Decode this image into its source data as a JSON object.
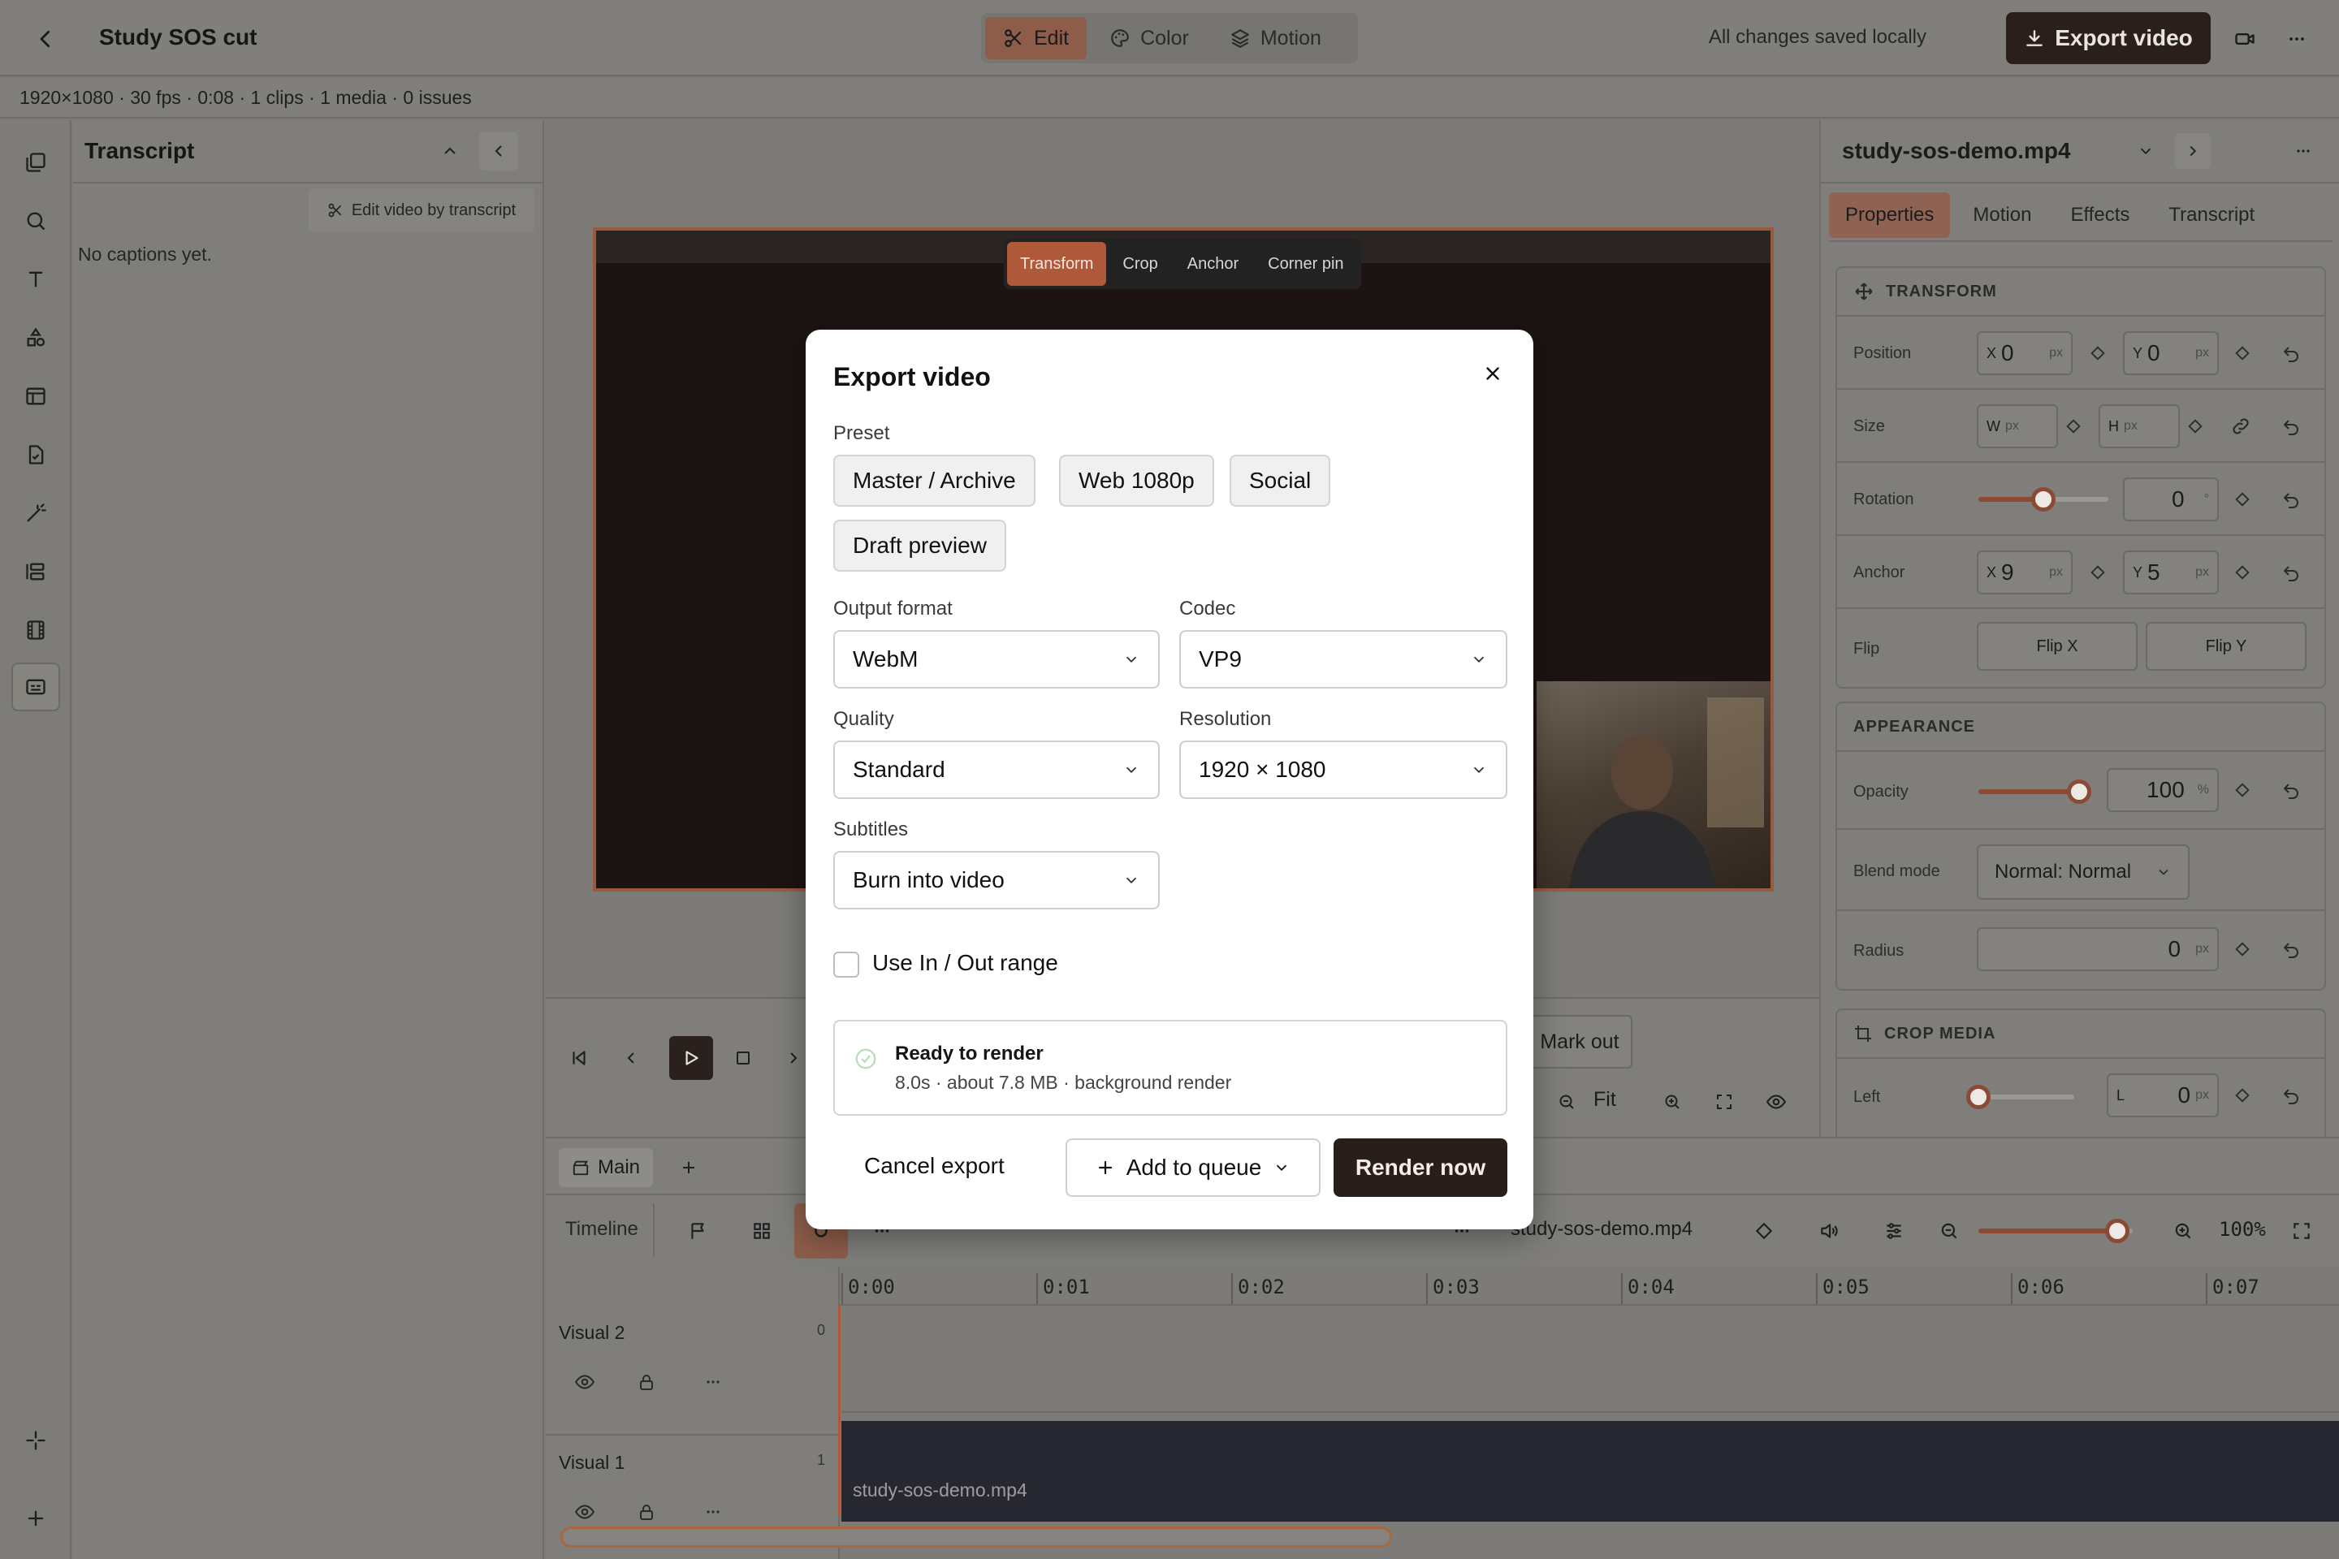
{
  "header": {
    "title": "Study SOS cut",
    "modes": [
      {
        "label": "Edit",
        "active": true
      },
      {
        "label": "Color",
        "active": false
      },
      {
        "label": "Motion",
        "active": false
      }
    ],
    "save_status": "All changes saved locally",
    "export_label": "Export video"
  },
  "meta": {
    "summary": "1920×1080 · 30 fps · 0:08 · 1 clips · 1 media · 0 issues"
  },
  "transcript_panel": {
    "title": "Transcript",
    "edit_by_transcript": "Edit video by transcript",
    "empty": "No captions yet."
  },
  "preview": {
    "transform_tools": [
      "Transform",
      "Crop",
      "Anchor",
      "Corner pin"
    ],
    "active_tool": "Transform",
    "mark_out": "Mark out",
    "fit": "Fit"
  },
  "timeline": {
    "tabs": [
      {
        "label": "Main"
      }
    ],
    "label": "Timeline",
    "clip_name": "study-sos-demo.mp4",
    "zoom_pct": "100%",
    "zoom_level": 0.9,
    "ticks": [
      "0:00",
      "0:01",
      "0:02",
      "0:03",
      "0:04",
      "0:05",
      "0:06",
      "0:07"
    ],
    "tracks": [
      {
        "name": "Visual 2",
        "index": "0"
      },
      {
        "name": "Visual 1",
        "index": "1"
      }
    ],
    "v1_clip_label": "study-sos-demo.mp4"
  },
  "props": {
    "file": "study-sos-demo.mp4",
    "tabs": [
      {
        "label": "Properties",
        "active": true
      },
      {
        "label": "Motion",
        "active": false
      },
      {
        "label": "Effects",
        "active": false
      },
      {
        "label": "Transcript",
        "active": false
      }
    ],
    "transform": {
      "title": "TRANSFORM",
      "position": {
        "label": "Position",
        "x": "0",
        "y": "0",
        "unit": "px"
      },
      "size": {
        "label": "Size",
        "w": "W",
        "h": "H",
        "unit": "px"
      },
      "rotation": {
        "label": "Rotation",
        "value": "0",
        "unit": "°",
        "level": 0.5
      },
      "anchor": {
        "label": "Anchor",
        "x": "9",
        "y": "5",
        "unit": "px"
      },
      "flip": {
        "label": "Flip",
        "x": "Flip X",
        "y": "Flip Y"
      }
    },
    "appearance": {
      "title": "APPEARANCE",
      "opacity": {
        "label": "Opacity",
        "value": "100",
        "unit": "%",
        "level": 1.0
      },
      "blend": {
        "label": "Blend mode",
        "value": "Normal: Normal"
      },
      "radius": {
        "label": "Radius",
        "value": "0",
        "unit": "px"
      }
    },
    "crop": {
      "title": "CROP MEDIA",
      "left": {
        "label": "Left",
        "prefix": "L",
        "value": "0",
        "unit": "px",
        "level": 0.0
      }
    }
  },
  "modal": {
    "title": "Export video",
    "preset_label": "Preset",
    "presets": [
      "Master / Archive",
      "Web 1080p",
      "Social",
      "Draft preview"
    ],
    "output_format": {
      "label": "Output format",
      "value": "WebM"
    },
    "codec": {
      "label": "Codec",
      "value": "VP9"
    },
    "quality": {
      "label": "Quality",
      "value": "Standard"
    },
    "resolution": {
      "label": "Resolution",
      "value": "1920 × 1080"
    },
    "subtitles": {
      "label": "Subtitles",
      "value": "Burn into video"
    },
    "range_label": "Use In / Out range",
    "status_title": "Ready to render",
    "status_detail": "8.0s · about 7.8 MB · background render",
    "cancel": "Cancel export",
    "queue": "Add to queue",
    "render": "Render now"
  },
  "colors": {
    "accent": "#b0583a",
    "dark_button": "#2a1e1b"
  }
}
